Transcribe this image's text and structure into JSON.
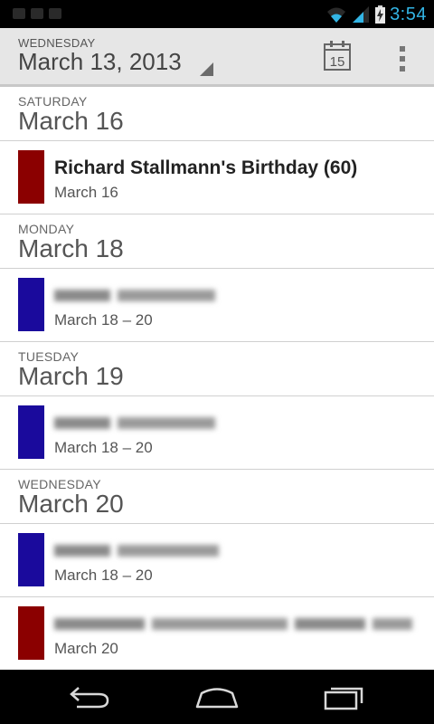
{
  "status_bar": {
    "time": "3:54",
    "accent_color": "#33b5e5"
  },
  "action_bar": {
    "weekday": "WEDNESDAY",
    "date": "March 13, 2013",
    "today_icon_number": "15"
  },
  "agenda": [
    {
      "weekday": "SATURDAY",
      "date": "March 16",
      "events": [
        {
          "title": "Richard Stallmann's Birthday (60)",
          "time": "March 16",
          "color": "#8b0000",
          "obscured": false
        }
      ]
    },
    {
      "weekday": "MONDAY",
      "date": "March 18",
      "events": [
        {
          "title": "",
          "time": "March 18 – 20",
          "color": "#1a0a9c",
          "obscured": true
        }
      ]
    },
    {
      "weekday": "TUESDAY",
      "date": "March 19",
      "events": [
        {
          "title": "",
          "time": "March 18 – 20",
          "color": "#1a0a9c",
          "obscured": true
        }
      ]
    },
    {
      "weekday": "WEDNESDAY",
      "date": "March 20",
      "events": [
        {
          "title": "",
          "time": "March 18 – 20",
          "color": "#1a0a9c",
          "obscured": true
        },
        {
          "title": "",
          "time": "March 20",
          "color": "#8b0000",
          "obscured": true
        }
      ]
    }
  ],
  "nav_icons": [
    "back-icon",
    "home-icon",
    "recent-apps-icon"
  ]
}
